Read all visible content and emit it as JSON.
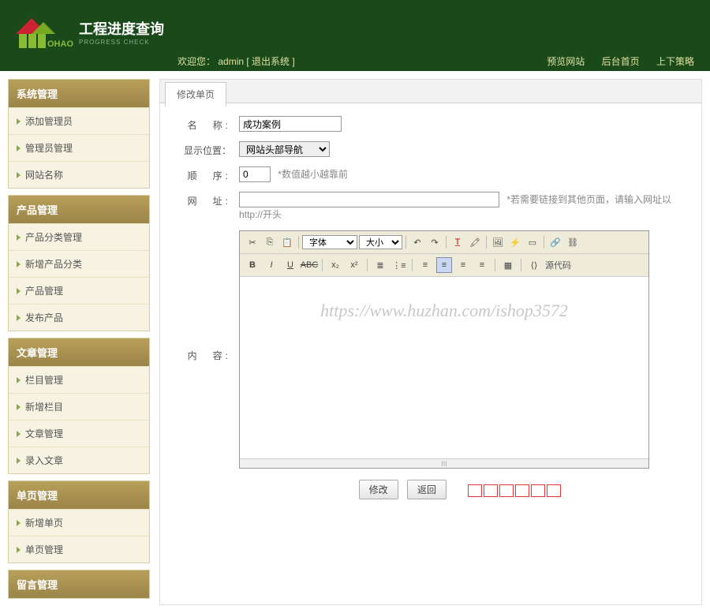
{
  "header": {
    "title": "工程进度查询",
    "subtitle": "PROGRESS CHECK",
    "welcome_prefix": "欢迎您：",
    "username": "admin",
    "logout": "[ 退出系统 ]",
    "nav": {
      "preview": "预览网站",
      "home": "后台首页",
      "policy": "上下策略"
    }
  },
  "sidebar": [
    {
      "head": "系统管理",
      "items": [
        "添加管理员",
        "管理员管理",
        "网站名称"
      ]
    },
    {
      "head": "产品管理",
      "items": [
        "产品分类管理",
        "新增产品分类",
        "产品管理",
        "发布产品"
      ]
    },
    {
      "head": "文章管理",
      "items": [
        "栏目管理",
        "新增栏目",
        "文章管理",
        "录入文章"
      ]
    },
    {
      "head": "单页管理",
      "items": [
        "新增单页",
        "单页管理"
      ]
    },
    {
      "head": "留言管理",
      "items": []
    }
  ],
  "tab": "修改单页",
  "form": {
    "name_label": "名称:",
    "name_value": "成功案例",
    "pos_label": "显示位置：",
    "pos_value": "网站头部导航",
    "order_label": "顺序:",
    "order_value": "0",
    "order_hint": "*数值越小越靠前",
    "url_label": "网址:",
    "url_value": "",
    "url_hint": "*若需要链接到其他页面，请输入网址以http://开头",
    "content_label": "内容:",
    "font_label": "字体",
    "size_label": "大小",
    "source_label": "源代码",
    "submit": "修改",
    "back": "返回"
  },
  "watermark": "https://www.huzhan.com/ishop3572"
}
